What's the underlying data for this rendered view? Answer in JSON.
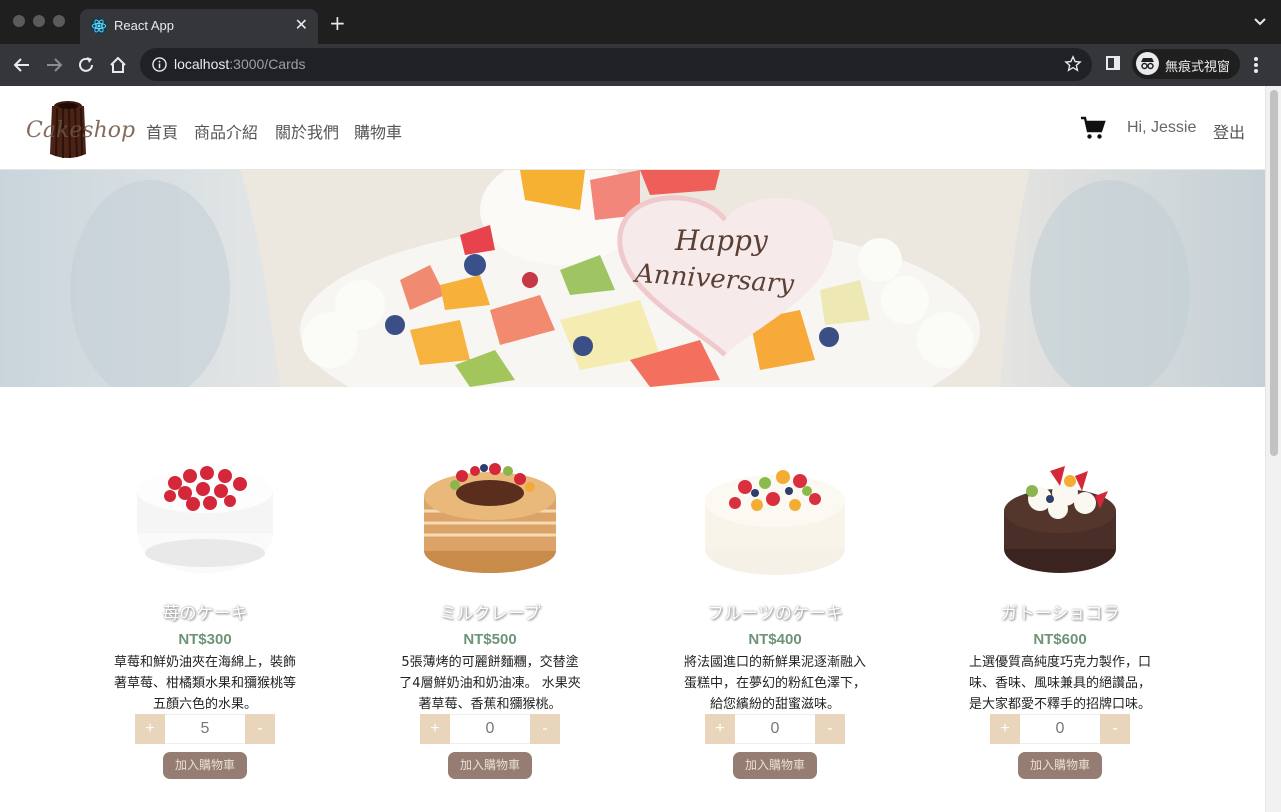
{
  "browser": {
    "tab_title": "React App",
    "url_host": "localhost",
    "url_rest": ":3000/Cards",
    "incognito_label": "無痕式視窗",
    "icons": [
      "react-icon",
      "close-icon",
      "plus-icon",
      "chevron-down-icon",
      "back-icon",
      "forward-icon",
      "reload-icon",
      "home-icon",
      "info-icon",
      "star-icon",
      "side-panel-icon",
      "incognito-icon",
      "kebab-menu-icon"
    ]
  },
  "site": {
    "logo_text": "Cakeshop",
    "nav": [
      "首頁",
      "商品介紹",
      "關於我們",
      "購物車"
    ],
    "greeting": "Hi, Jessie",
    "logout": "登出",
    "banner_text": [
      "Happy",
      "Anniversary"
    ]
  },
  "products": [
    {
      "name": "苺のケーキ",
      "price": "NT$300",
      "desc": [
        "草莓和鮮奶油夾在海綿上，裝飾",
        "著草莓、柑橘類水果和獼猴桃等",
        "五顏六色的水果。"
      ],
      "qty": "5",
      "plus": "+",
      "minus": "-",
      "add": "加入購物車"
    },
    {
      "name": "ミルクレープ",
      "price": "NT$500",
      "desc": [
        "5張薄烤的可麗餅麵糰，交替塗",
        "了4層鮮奶油和奶油凍。 水果夾",
        "著草莓、香蕉和獼猴桃。"
      ],
      "qty": "0",
      "plus": "+",
      "minus": "-",
      "add": "加入購物車"
    },
    {
      "name": "フルーツのケーキ",
      "price": "NT$400",
      "desc": [
        "將法國進口的新鮮果泥逐漸融入",
        "蛋糕中，在夢幻的粉紅色澤下，",
        "給您繽紛的甜蜜滋味。"
      ],
      "qty": "0",
      "plus": "+",
      "minus": "-",
      "add": "加入購物車"
    },
    {
      "name": "ガトーショコラ",
      "price": "NT$600",
      "desc": [
        "上選優質高純度巧克力製作，口",
        "味、香味、風味兼具的絕讚品，",
        "是大家都愛不釋手的招牌口味。"
      ],
      "qty": "0",
      "plus": "+",
      "minus": "-",
      "add": "加入購物車"
    }
  ],
  "colors": {
    "price": "#6e9478",
    "stepper": "#e8d5bc",
    "add_button": "#957d73"
  }
}
